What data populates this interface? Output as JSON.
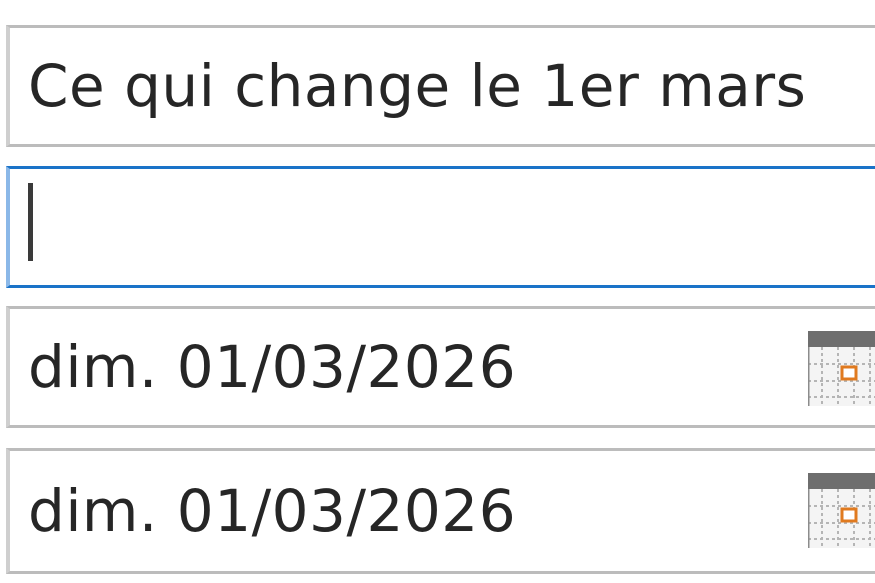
{
  "subject": {
    "value": "Ce qui change le 1er mars"
  },
  "location": {
    "value": ""
  },
  "start_date": {
    "value": "dim. 01/03/2026",
    "icon": "calendar-icon"
  },
  "end_date": {
    "value": "dim. 01/03/2026",
    "icon": "calendar-icon"
  },
  "colors": {
    "focus_border": "#1a73c8",
    "field_border": "#bcbcbc",
    "calendar_header": "#6e6e6e",
    "calendar_today": "#e07a1f"
  }
}
